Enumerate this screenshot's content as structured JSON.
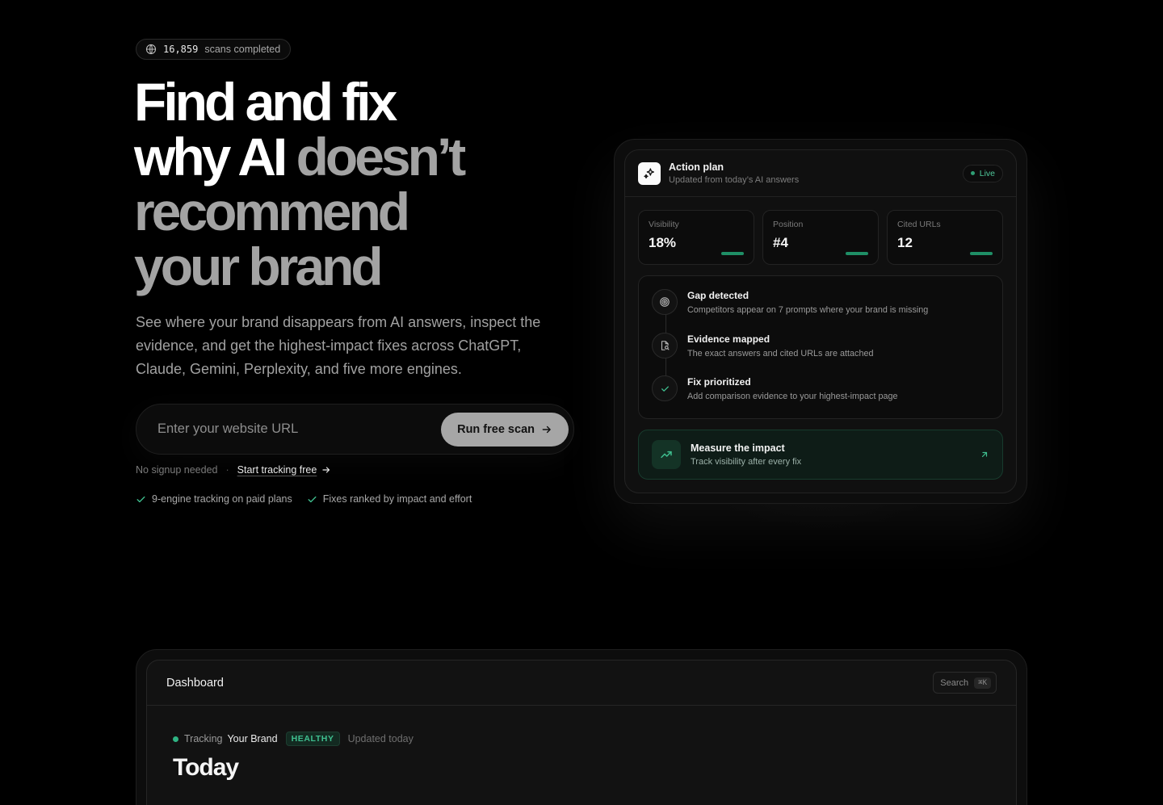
{
  "hero": {
    "scans_count": "16,859",
    "scans_label": "scans completed",
    "headline": {
      "line1": "Find and fix",
      "line2_white": "why AI",
      "line2_gray": "doesn’t",
      "line3": "recommend",
      "line4": "your brand"
    },
    "subheadline": "See where your brand disappears from AI answers, inspect the evidence, and get the highest-impact fixes across ChatGPT, Claude, Gemini, Perplexity, and five more engines.",
    "url_input": {
      "placeholder": "Enter your website URL",
      "value": ""
    },
    "cta_label": "Run free scan",
    "no_signup": "No signup needed",
    "separator": "·",
    "tracking_link": "Start tracking free",
    "checks": [
      "9-engine tracking on paid plans",
      "Fixes ranked by impact and effort"
    ]
  },
  "action_plan": {
    "title": "Action plan",
    "subtitle": "Updated from today’s AI answers",
    "status": "Live",
    "stats": [
      {
        "label": "Visibility",
        "value": "18%"
      },
      {
        "label": "Position",
        "value": "#4"
      },
      {
        "label": "Cited URLs",
        "value": "12"
      }
    ],
    "steps": [
      {
        "title": "Gap detected",
        "text": "Competitors appear on 7 prompts where your brand is missing",
        "icon": "target-icon"
      },
      {
        "title": "Evidence mapped",
        "text": "The exact answers and cited URLs are attached",
        "icon": "file-search-icon"
      },
      {
        "title": "Fix prioritized",
        "text": "Add comparison evidence to your highest-impact page",
        "icon": "check-icon"
      }
    ],
    "measure": {
      "title": "Measure the impact",
      "text": "Track visibility after every fix"
    }
  },
  "dashboard": {
    "title": "Dashboard",
    "search_label": "Search",
    "search_shortcut": "⌘K",
    "tracking_label": "Tracking",
    "brand": "Your Brand",
    "health_badge": "HEALTHY",
    "updated": "Updated today",
    "heading": "Today"
  },
  "colors": {
    "background": "#000000",
    "accent_green": "#2f9e74",
    "text_muted": "#a1a1a1"
  }
}
